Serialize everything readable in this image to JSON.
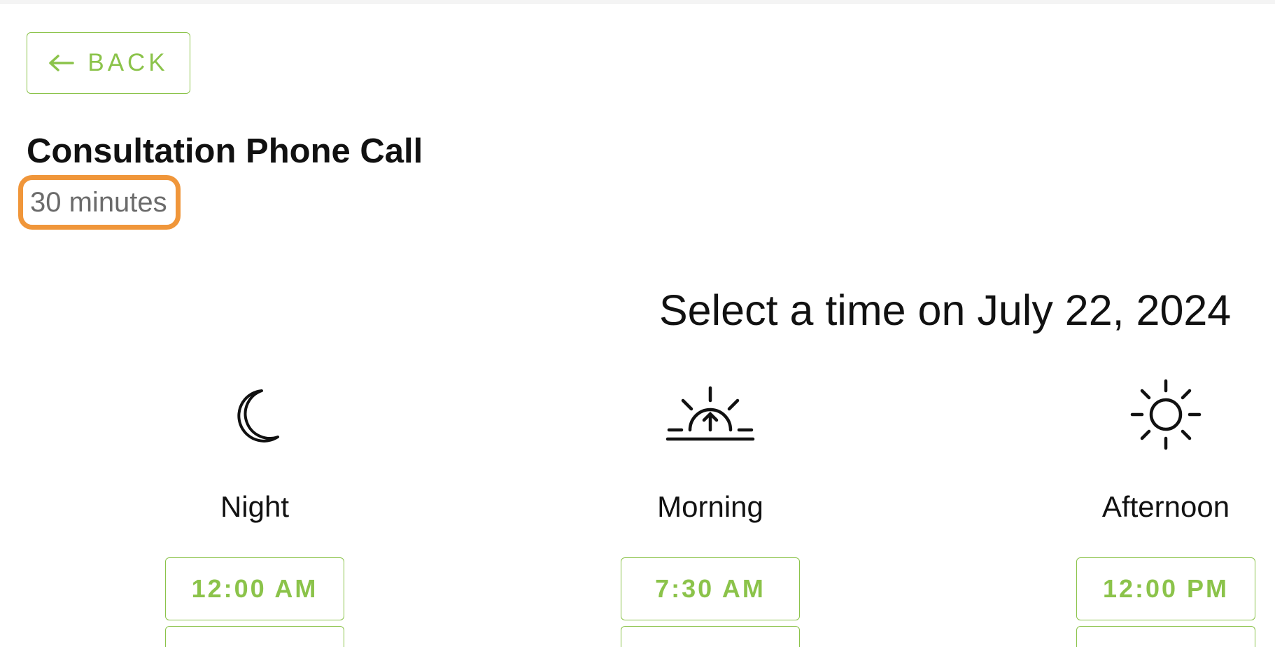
{
  "back_button": {
    "label": "BACK",
    "icon": "arrow-left-icon"
  },
  "event": {
    "title": "Consultation Phone Call",
    "duration": "30 minutes"
  },
  "highlight_color": "#f0963a",
  "accent_color": "#8bc34a",
  "select_heading": "Select a time on July 22, 2024",
  "periods": [
    {
      "label": "Night",
      "icon": "moon-icon",
      "first_slot": "12:00 AM"
    },
    {
      "label": "Morning",
      "icon": "sunrise-icon",
      "first_slot": "7:30 AM"
    },
    {
      "label": "Afternoon",
      "icon": "sun-icon",
      "first_slot": "12:00 PM"
    }
  ]
}
